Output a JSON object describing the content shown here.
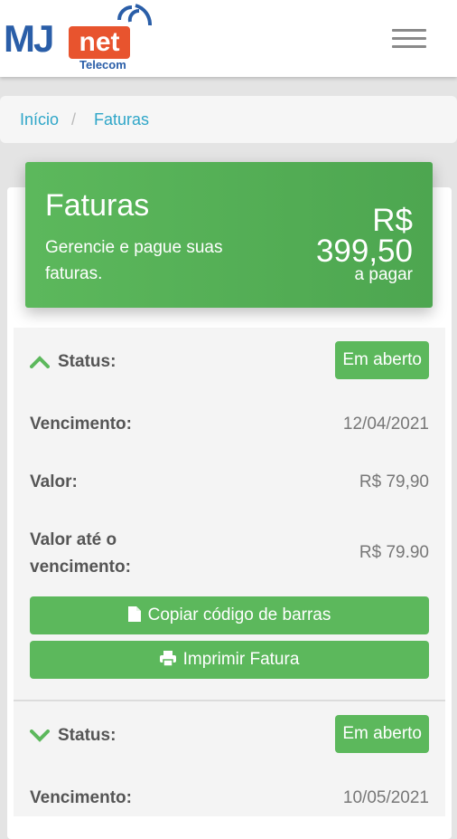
{
  "header": {
    "logo": {
      "brand": "MJ",
      "net": "net",
      "sub": "Telecom"
    },
    "menu_icon": "hamburger-icon"
  },
  "breadcrumb": {
    "items": [
      "Início",
      "Faturas"
    ],
    "separator": "/"
  },
  "summary": {
    "title": "Faturas",
    "description": "Gerencie e pague suas faturas.",
    "amount": "R$ 399,50",
    "amount_label": "a pagar"
  },
  "labels": {
    "status": "Status:",
    "due_date": "Vencimento:",
    "value": "Valor:",
    "value_until_due": "Valor até o vencimento:",
    "copy_barcode": "Copiar código de barras",
    "print_invoice": "Imprimir Fatura"
  },
  "invoices": [
    {
      "status": "Em aberto",
      "due_date": "12/04/2021",
      "value": "R$ 79,90",
      "value_until_due": "R$ 79.90",
      "expanded": true
    },
    {
      "status": "Em aberto",
      "due_date": "10/05/2021",
      "expanded": false
    }
  ],
  "colors": {
    "accent": "#5cb85c",
    "link": "#2fa6c8",
    "logo_blue": "#2a5ea8",
    "logo_orange": "#e8542e"
  }
}
